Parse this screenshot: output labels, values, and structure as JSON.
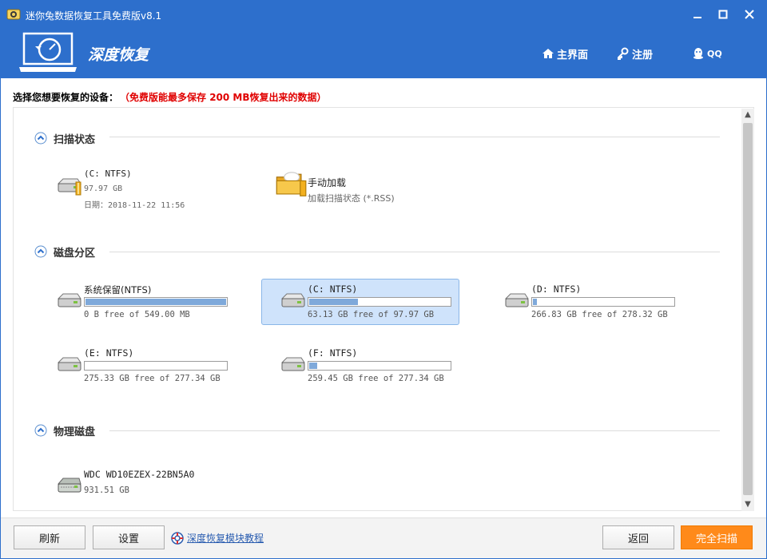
{
  "window": {
    "title": "迷你兔数据恢复工具免费版v8.1"
  },
  "header": {
    "brand": "深度恢复",
    "nav": [
      {
        "label": "主界面",
        "icon": "home-icon"
      },
      {
        "label": "注册",
        "icon": "key-icon"
      },
      {
        "label": "QQ",
        "icon": "qq-penguin-icon"
      }
    ]
  },
  "prompt": {
    "text": "选择您想要恢复的设备：",
    "warning": "（免费版能最多保存 200 MB恢复出来的数据）"
  },
  "sections": {
    "scan_state": {
      "title": "扫描状态",
      "items": [
        {
          "name": "(C: NTFS)",
          "size": "97.97 GB",
          "date": "日期：2018-11-22 11:56",
          "icon": "drive-icon"
        },
        {
          "name": "手动加载",
          "subtitle": "加载扫描状态 (*.RSS)",
          "icon": "folder-icon"
        }
      ]
    },
    "partitions": {
      "title": "磁盘分区",
      "items": [
        {
          "name": "系统保留(NTFS)",
          "free": "0 B free of 549.00 MB",
          "used_fraction": 1.0
        },
        {
          "name": "(C: NTFS)",
          "free": "63.13 GB free of 97.97 GB",
          "used_fraction": 0.356
        },
        {
          "name": "(D: NTFS)",
          "free": "266.83 GB free of 278.32 GB",
          "used_fraction": 0.041
        },
        {
          "name": "(E: NTFS)",
          "free": "275.33 GB free of 277.34 GB",
          "used_fraction": 0.007
        },
        {
          "name": "(F: NTFS)",
          "free": "259.45 GB free of 277.34 GB",
          "used_fraction": 0.065
        }
      ]
    },
    "physical": {
      "title": "物理磁盘",
      "items": [
        {
          "name": "WDC WD10EZEX-22BN5A0",
          "size": "931.51 GB",
          "icon": "hard-disk-icon"
        }
      ]
    }
  },
  "footer": {
    "refresh": "刷新",
    "settings": "设置",
    "help_link": "深度恢复模块教程",
    "back": "返回",
    "full_scan": "完全扫描"
  },
  "colors": {
    "accent": "#2d6fcc",
    "warning": "#e00000",
    "primary_button": "#ff8a1a",
    "selected": "#cfe3fb"
  }
}
